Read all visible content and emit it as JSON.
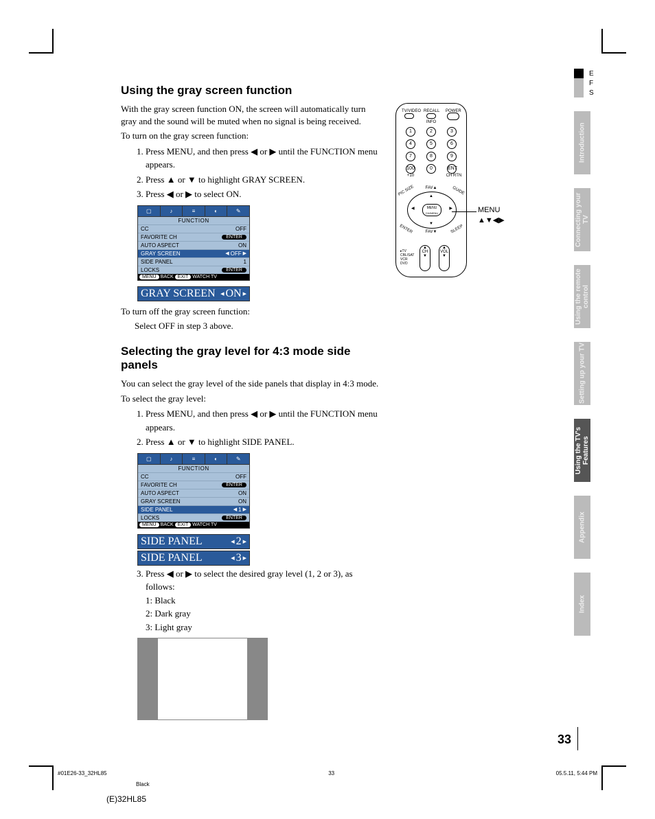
{
  "lang_tabs": {
    "e": "E",
    "f": "F",
    "s": "S"
  },
  "side_tabs": [
    "Introduction",
    "Connecting your TV",
    "Using the remote control",
    "Setting up your TV",
    "Using the TV's Features",
    "Appendix",
    "Index"
  ],
  "section1": {
    "heading": "Using the gray screen function",
    "p1": "With the gray screen function ON, the screen will automatically turn gray and the sound will be muted when no signal is being received.",
    "p2": "To turn on the gray screen function:",
    "steps": [
      "Press MENU, and then press ◀ or ▶ until the FUNCTION menu appears.",
      "Press ▲ or ▼ to highlight GRAY SCREEN.",
      "Press ◀ or ▶ to select ON."
    ],
    "p3": "To turn off the gray screen function:",
    "p4": "Select OFF in step 3 above."
  },
  "osd1": {
    "title": "FUNCTION",
    "rows": [
      {
        "label": "CC",
        "value": "OFF",
        "hl": false,
        "pill": false
      },
      {
        "label": "FAVORITE CH",
        "value": "ENTER",
        "hl": false,
        "pill": true
      },
      {
        "label": "AUTO ASPECT",
        "value": "ON",
        "hl": false,
        "pill": false
      },
      {
        "label": "GRAY SCREEN",
        "value": "OFF",
        "hl": true,
        "pill": false,
        "arrows": true
      },
      {
        "label": "SIDE PANEL",
        "value": "1",
        "hl": false,
        "pill": false
      },
      {
        "label": "LOCKS",
        "value": "ENTER",
        "hl": false,
        "pill": true
      }
    ],
    "footer": {
      "menu": "MENU",
      "back": "BACK",
      "exit": "EXIT",
      "watch": "WATCH TV"
    },
    "extra": {
      "label": "GRAY SCREEN",
      "value": "ON"
    }
  },
  "section2": {
    "heading": "Selecting the gray level for 4:3 mode side panels",
    "p1": "You can select the gray level of the side panels that display in 4:3 mode.",
    "p2": "To select the gray level:",
    "steps12": [
      "Press MENU, and then press ◀ or ▶ until the FUNCTION menu appears.",
      "Press ▲ or ▼ to highlight SIDE PANEL."
    ],
    "step3": "Press ◀ or ▶ to select the desired gray level (1, 2 or 3), as follows:",
    "levels": [
      "1: Black",
      "2: Dark gray",
      "3: Light gray"
    ]
  },
  "osd2": {
    "title": "FUNCTION",
    "rows": [
      {
        "label": "CC",
        "value": "OFF",
        "hl": false,
        "pill": false
      },
      {
        "label": "FAVORITE CH",
        "value": "ENTER",
        "hl": false,
        "pill": true
      },
      {
        "label": "AUTO ASPECT",
        "value": "ON",
        "hl": false,
        "pill": false
      },
      {
        "label": "GRAY SCREEN",
        "value": "ON",
        "hl": false,
        "pill": false
      },
      {
        "label": "SIDE PANEL",
        "value": "1",
        "hl": true,
        "pill": false,
        "arrows": true
      },
      {
        "label": "LOCKS",
        "value": "ENTER",
        "hl": false,
        "pill": true
      }
    ],
    "footer": {
      "menu": "MENU",
      "back": "BACK",
      "exit": "EXIT",
      "watch": "WATCH TV"
    },
    "extra": [
      {
        "label": "SIDE PANEL",
        "value": "2"
      },
      {
        "label": "SIDE PANEL",
        "value": "3"
      }
    ]
  },
  "remote": {
    "top_labels": [
      "TV/VIDEO",
      "RECALL",
      "POWER",
      "INFO"
    ],
    "keys": [
      "1",
      "2",
      "3",
      "4",
      "5",
      "6",
      "7",
      "8",
      "9",
      "100",
      "0",
      "ENT"
    ],
    "sub_labels": [
      "+10",
      "CH RTN"
    ],
    "fav": "FAV▲",
    "favd": "FAV▼",
    "ring_labels": [
      "PIC SIZE",
      "GUIDE",
      "ENTER",
      "SLEEP"
    ],
    "center": [
      "MENU",
      "CH/MENU"
    ],
    "sw": [
      "TV",
      "CBL/SAT",
      "VCR",
      "DVD"
    ],
    "ch": "CH",
    "vol": "VOL",
    "callout1": "MENU",
    "callout2": "▲▼◀▶"
  },
  "page_number": "33",
  "footer": {
    "left": "#01E26-33_32HL85",
    "center": "33",
    "right": "05.5.11, 5:44 PM",
    "black": "Black"
  },
  "model": "(E)32HL85"
}
